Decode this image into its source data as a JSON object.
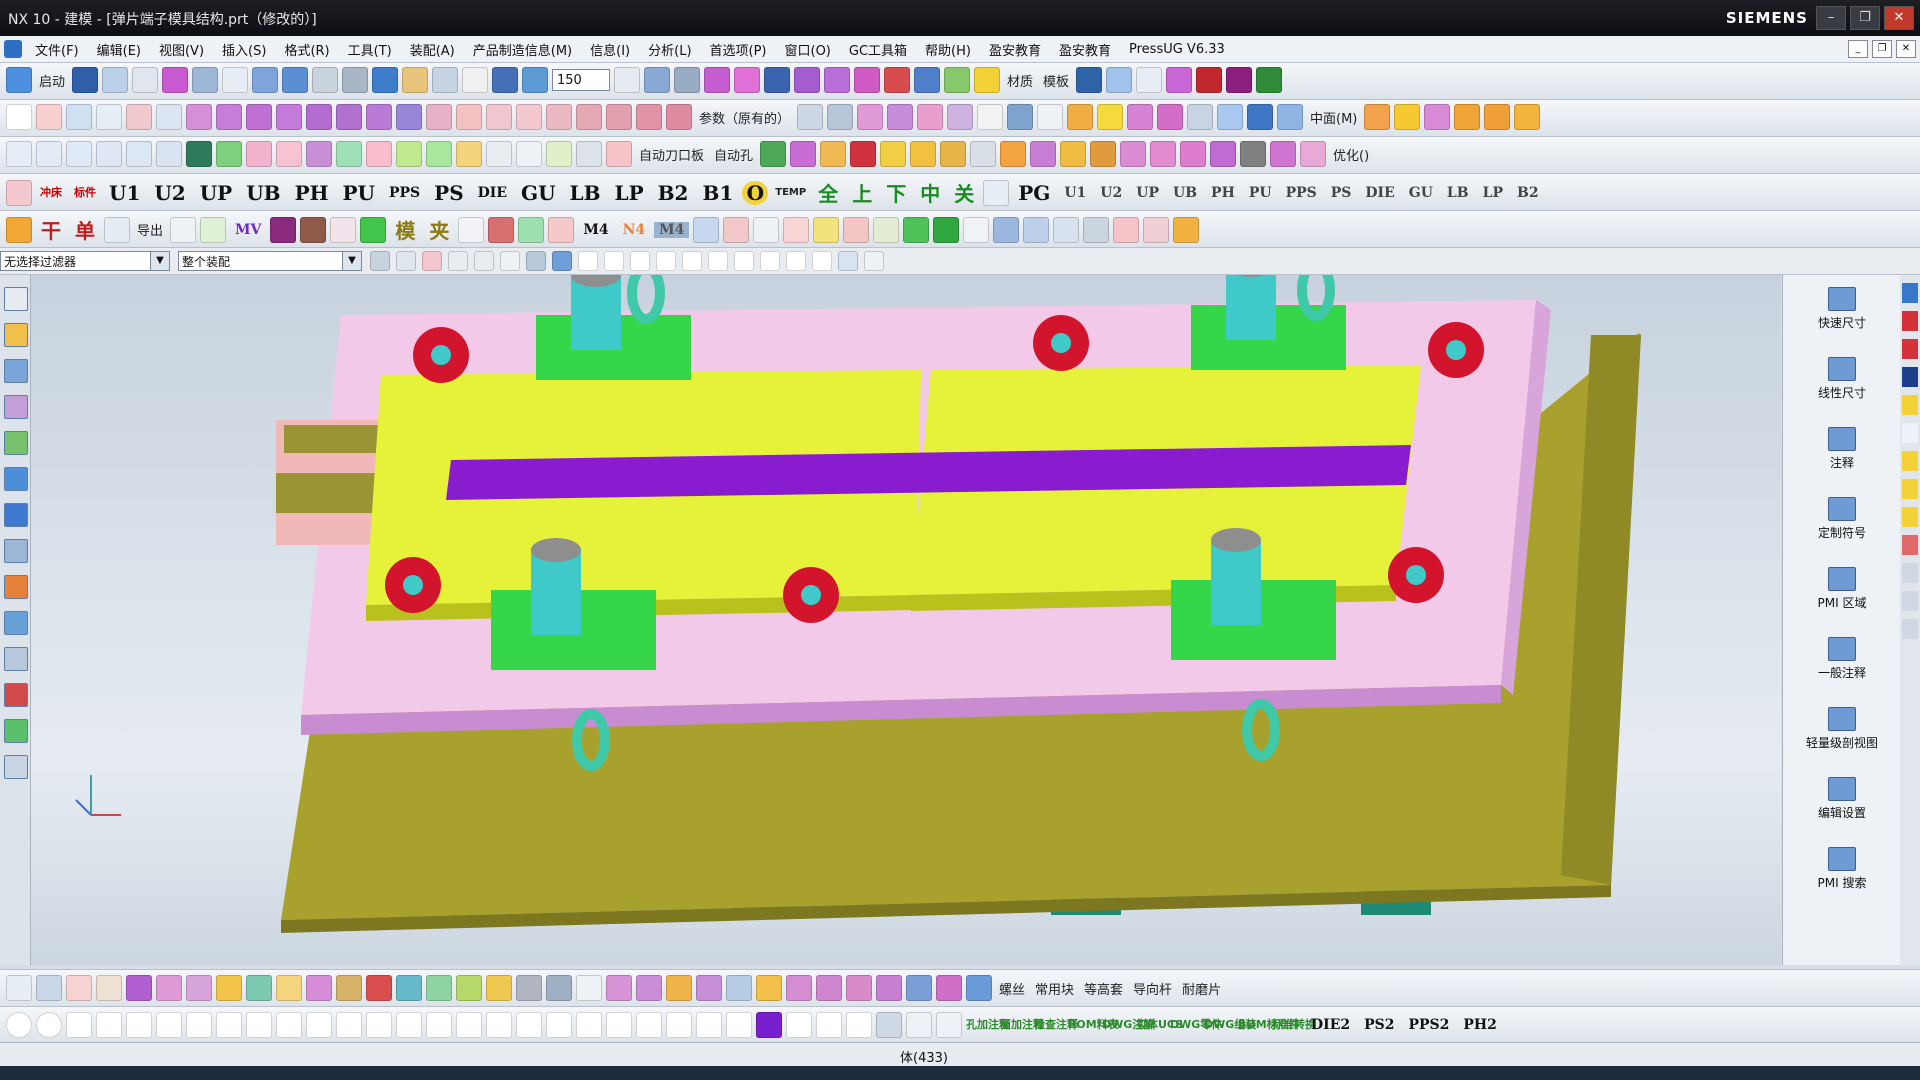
{
  "window": {
    "title": "NX 10 - 建模 - [弹片端子模具结构.prt（修改的）]",
    "brand": "SIEMENS",
    "controls": [
      "–",
      "❐",
      "✕"
    ]
  },
  "menu": [
    "文件(F)",
    "编辑(E)",
    "视图(V)",
    "插入(S)",
    "格式(R)",
    "工具(T)",
    "装配(A)",
    "产品制造信息(M)",
    "信息(I)",
    "分析(L)",
    "首选项(P)",
    "窗口(O)",
    "GC工具箱",
    "帮助(H)",
    "盈安教育",
    "盈安教育",
    "PressUG V6.33"
  ],
  "toolbar1": {
    "start_label": "启动",
    "zoom_value": "150",
    "text_labels": [
      "材质",
      "模板"
    ]
  },
  "toolbar2": {
    "labels": [
      "参数（原有的）",
      "中面(M)"
    ]
  },
  "toolbar3": {
    "labels": [
      "自动刀口板",
      "自动孔",
      "优化()"
    ]
  },
  "toolbar4": {
    "left_labels": [
      "冲床",
      "标件"
    ],
    "plate_labels": [
      "U1",
      "U2",
      "UP",
      "UB",
      "PH",
      "PU",
      "PPS",
      "PS",
      "DIE",
      "GU",
      "LB",
      "LP",
      "B2",
      "B1"
    ],
    "symbol_label": "O",
    "temp_label": "TEMP",
    "cn_labels": [
      "全",
      "上",
      "下",
      "中",
      "关"
    ],
    "pg_label": "PG",
    "right_labels": [
      "U1",
      "U2",
      "UP",
      "UB",
      "PH",
      "PU",
      "PPS",
      "PS",
      "DIE",
      "GU",
      "LB",
      "LP",
      "B2"
    ]
  },
  "toolbar5": {
    "labels": [
      "干",
      "单",
      "导出",
      "MV",
      "模",
      "夹",
      "M4",
      "N4",
      "M4"
    ]
  },
  "filter": {
    "selection_filter": "无选择过滤器",
    "assembly_scope": "整个装配"
  },
  "right_panel": {
    "items": [
      "快速尺寸",
      "线性尺寸",
      "注释",
      "定制符号",
      "PMI 区域",
      "一般注释",
      "轻量级剖视图",
      "编辑设置",
      "PMI 搜索"
    ]
  },
  "bottom1": {
    "labels": [
      "螺丝",
      "常用块",
      "等高套",
      "导向杆",
      "耐磨片"
    ]
  },
  "bottom2": {
    "labels": [
      "孔加注释",
      "面加注释",
      "检查注释",
      "BOM料表",
      "DWG注解",
      "实体UCS",
      "DWG零件",
      "DWG组装",
      "BOM标准件",
      "标准转换",
      "DIE2",
      "PS2",
      "PPS2",
      "PH2"
    ]
  },
  "status": {
    "text": "体(433)"
  },
  "colors": {
    "plate_pink": "#f2c9e8",
    "plate_yellow": "#e6f23a",
    "base_olive": "#a8a12e",
    "bolt_green": "#35d64a",
    "pillar_cyan": "#3fc9c9",
    "bushing_red": "#d2142d",
    "strip_purple": "#8a1ccf"
  }
}
